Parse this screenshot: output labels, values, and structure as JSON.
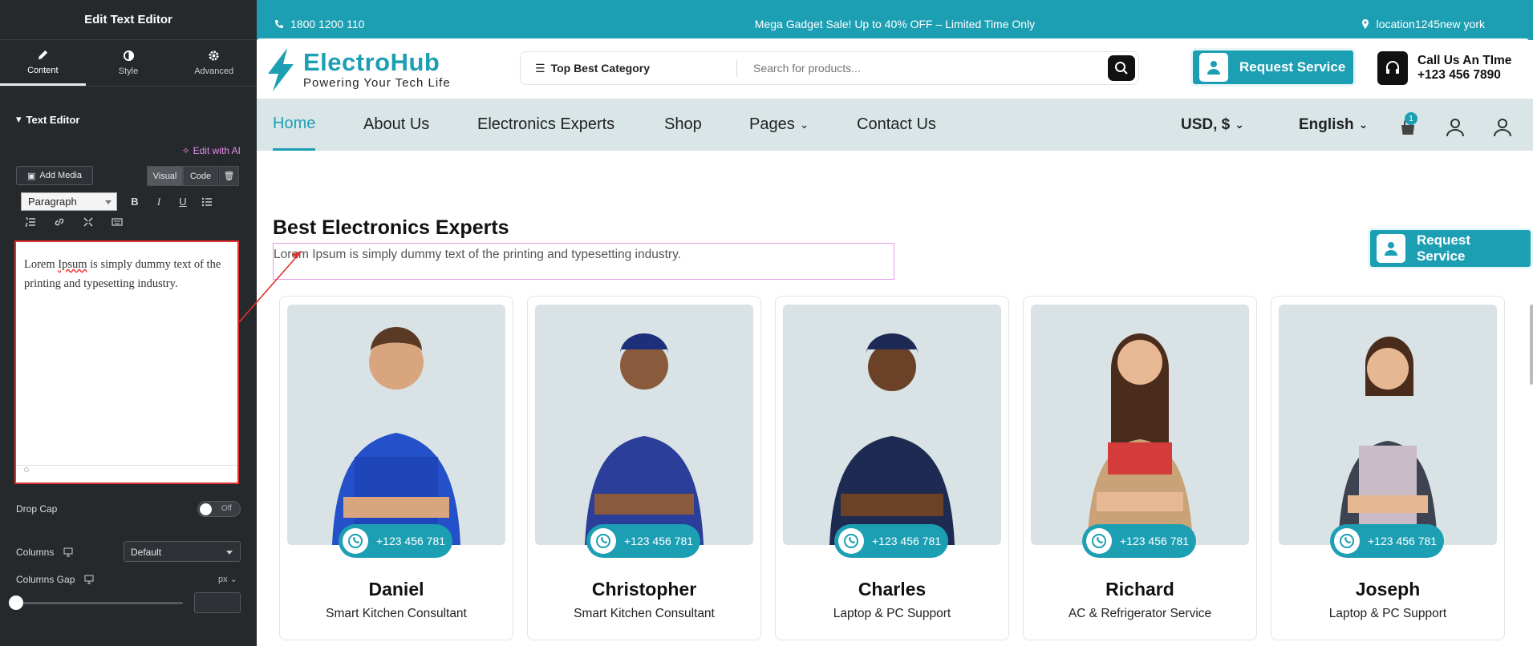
{
  "panel": {
    "title": "Edit Text Editor",
    "tabs": [
      {
        "label": "Content",
        "icon": "pencil-icon"
      },
      {
        "label": "Style",
        "icon": "contrast-icon"
      },
      {
        "label": "Advanced",
        "icon": "gear-icon"
      }
    ],
    "section_title": "Text Editor",
    "ai_link": "Edit with AI",
    "add_media": "Add Media",
    "visual_tab": "Visual",
    "code_tab": "Code",
    "format_select": "Paragraph",
    "editor_text": {
      "w1": "Lorem",
      "w2": "Ipsum",
      "rest": "is simply dummy text of the printing and typesetting industry."
    },
    "drop_cap_label": "Drop Cap",
    "drop_cap_toggle": "Off",
    "columns_label": "Columns",
    "columns_value": "Default",
    "columns_gap_label": "Columns Gap",
    "gap_unit": "px"
  },
  "site": {
    "topbar": {
      "phone": "1800 1200 110",
      "sale": "Mega Gadget Sale! Up to 40% OFF – Limited Time Only",
      "location": "location1245new york"
    },
    "logo": {
      "brand": "ElectroHub",
      "tagline": "Powering Your Tech Life"
    },
    "search": {
      "category": "Top Best Category",
      "placeholder": "Search for products..."
    },
    "request_service": "Request Service",
    "call": {
      "line1": "Call Us An TIme",
      "line2": "+123 456 7890"
    },
    "nav": [
      "Home",
      "About Us",
      "Electronics Experts",
      "Shop",
      "Pages",
      "Contact Us"
    ],
    "currency": "USD, $",
    "language": "English",
    "cart_count": "1",
    "section": {
      "title": "Best Electronics Experts",
      "desc": "Lorem Ipsum is simply dummy text of the printing and typesetting industry."
    },
    "experts": [
      {
        "name": "Daniel",
        "role": "Smart Kitchen Consultant",
        "phone": "+123 456 781"
      },
      {
        "name": "Christopher",
        "role": "Smart Kitchen Consultant",
        "phone": "+123 456 781"
      },
      {
        "name": "Charles",
        "role": "Laptop & PC Support",
        "phone": "+123 456 781"
      },
      {
        "name": "Richard",
        "role": "AC & Refrigerator Service",
        "phone": "+123 456 781"
      },
      {
        "name": "Joseph",
        "role": "Laptop & PC Support",
        "phone": "+123 456 781"
      }
    ]
  },
  "colors": {
    "accent": "#1d9fb3",
    "panel_bg": "#26292c",
    "nav_bg": "#d9e5e7",
    "annotation_red": "#e23030"
  }
}
